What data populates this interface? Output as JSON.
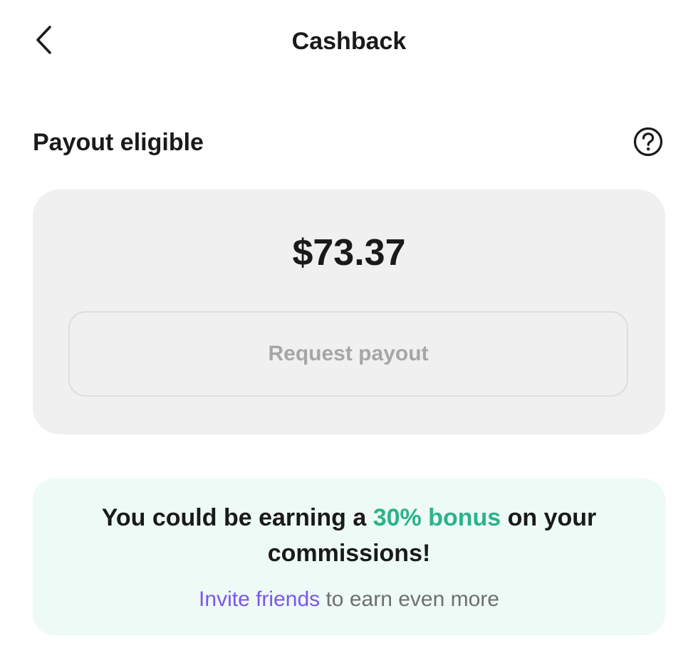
{
  "header": {
    "title": "Cashback",
    "back_icon": "chevron-left-icon"
  },
  "payout_section": {
    "title": "Payout eligible",
    "help_icon": "question-circle-icon",
    "amount": "$73.37",
    "request_button_label": "Request payout"
  },
  "promo": {
    "text_before": "You could be earning a ",
    "bonus_text": "30% bonus",
    "text_after": " on your commissions!",
    "invite_link_label": "Invite friends",
    "invite_suffix": " to earn even more"
  },
  "colors": {
    "bonus_green": "#2bb38a",
    "invite_purple": "#7b55f0",
    "card_background": "#f0f0f0",
    "promo_background": "#eefaf6"
  }
}
